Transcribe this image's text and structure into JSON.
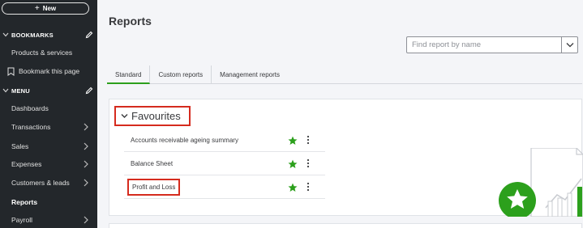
{
  "sidebar": {
    "new_label": "New",
    "bookmarks_header": "BOOKMARKS",
    "bookmarks_items": [
      {
        "label": "Products & services"
      },
      {
        "label": "Bookmark this page"
      }
    ],
    "menu_header": "MENU",
    "menu_items": [
      {
        "label": "Dashboards"
      },
      {
        "label": "Transactions"
      },
      {
        "label": "Sales"
      },
      {
        "label": "Expenses"
      },
      {
        "label": "Customers & leads"
      },
      {
        "label": "Reports"
      },
      {
        "label": "Payroll"
      }
    ]
  },
  "main": {
    "title": "Reports",
    "search_placeholder": "Find report by name",
    "tabs": [
      {
        "label": "Standard"
      },
      {
        "label": "Custom reports"
      },
      {
        "label": "Management reports"
      }
    ],
    "favourites": {
      "title": "Favourites",
      "items": [
        {
          "label": "Accounts receivable ageing summary"
        },
        {
          "label": "Balance Sheet"
        },
        {
          "label": "Profit and Loss"
        }
      ]
    }
  },
  "colors": {
    "sidebar_bg": "#23272b",
    "accent_green": "#2ca01c",
    "highlight_red": "#d52b1e"
  }
}
